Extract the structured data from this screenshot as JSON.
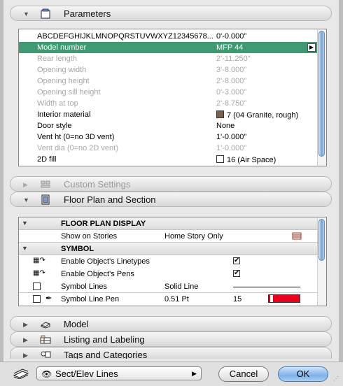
{
  "sections": {
    "parameters": "Parameters",
    "custom_settings": "Custom Settings",
    "floor_plan": "Floor Plan and Section",
    "model": "Model",
    "listing": "Listing and Labeling",
    "tags": "Tags and Categories"
  },
  "parameters": [
    {
      "name": "ABCDEFGHIJKLMNOPQRSTUVWXYZ12345678...",
      "value": "0'-0.000\"",
      "state": "normal"
    },
    {
      "name": "Model number",
      "value": "MFP 44",
      "state": "selected"
    },
    {
      "name": "Rear length",
      "value": "2'-11.250\"",
      "state": "disabled"
    },
    {
      "name": "Opening width",
      "value": "3'-8.000\"",
      "state": "disabled"
    },
    {
      "name": "Opening height",
      "value": "2'-8.000\"",
      "state": "disabled"
    },
    {
      "name": "Opening sill height",
      "value": "0'-3.000\"",
      "state": "disabled"
    },
    {
      "name": "Width at top",
      "value": "2'-8.750\"",
      "state": "disabled"
    },
    {
      "name": "Interior material",
      "value": "7 (04 Granite, rough)",
      "state": "normal"
    },
    {
      "name": "Door style",
      "value": "None",
      "state": "normal"
    },
    {
      "name": "Vent ht (0=no 3D vent)",
      "value": "1'-0.000\"",
      "state": "normal"
    },
    {
      "name": "Vent dia (0=no 2D vent)",
      "value": "1'-0.000\"",
      "state": "disabled"
    },
    {
      "name": "2D fill",
      "value": "16 (Air Space)",
      "state": "normal"
    }
  ],
  "floorplan": {
    "group1": "FLOOR PLAN DISPLAY",
    "show_on_stories_label": "Show on Stories",
    "show_on_stories_value": "Home Story Only",
    "group2": "SYMBOL",
    "linetypes_label": "Enable Object's Linetypes",
    "pens_label": "Enable Object's Pens",
    "check_mark": "✔",
    "symbol_lines_label": "Symbol Lines",
    "symbol_lines_value": "Solid Line",
    "symbol_pen_label": "Symbol Line Pen",
    "symbol_pen_value": "0.51 Pt",
    "symbol_pen_number": "15"
  },
  "colors": {
    "selected_row": "#3d9a73",
    "material_swatch": "#7a604e",
    "pen_color": "#e8001c"
  },
  "footer": {
    "layer": "Sect/Elev Lines",
    "cancel": "Cancel",
    "ok": "OK"
  }
}
